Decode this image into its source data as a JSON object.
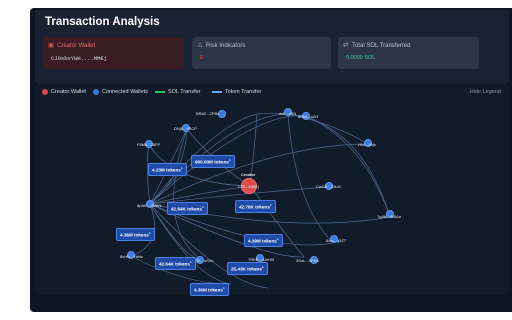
{
  "title": "Transaction Analysis",
  "cards": {
    "creator_wallet": {
      "label": "Creator Wallet",
      "value": "CJ9sbvYWH....MMEj"
    },
    "risk": {
      "label": "Risk Indicators",
      "value": "0"
    },
    "total_sol": {
      "label": "Total SOL Transferred",
      "value": "0.0000 SOL"
    }
  },
  "legend": {
    "creator": "Creator Wallet",
    "connected": "Connected Wallets",
    "sol": "SOL Transfer",
    "token": "Token Transfer",
    "hide": "Hide Legend"
  },
  "colors": {
    "creator": "#e04a4a",
    "connected": "#3b7be0",
    "sol": "#22c55e",
    "token": "#60a5fa",
    "risk": "#e05555",
    "total": "#34d399"
  },
  "graph": {
    "creator": {
      "top": "Creator",
      "bottom": "CJ9...MMEj"
    },
    "nodes": [
      "BRsE...2PBx",
      "rbC...a5N",
      "8Nk5...oZH",
      "DNj8...9RCP",
      "F5M8...28FP",
      "Hhd...9xjk",
      "CwGE...Z9uG",
      "6pNE...dMWe",
      "7g4M...fkBAu",
      "8xm...g5Z7",
      "8cHB...YhNz",
      "GK...sSVo",
      "7REE...dJeHN",
      "3SuL...3PDU"
    ],
    "badges": [
      "900.00M tokens",
      "4.23M tokens",
      "42.64K tokens",
      "42.76K tokens",
      "4.39M tokens",
      "4.36M tokens",
      "42.64K tokens",
      "25.43K tokens",
      "4.36M tokens"
    ]
  }
}
